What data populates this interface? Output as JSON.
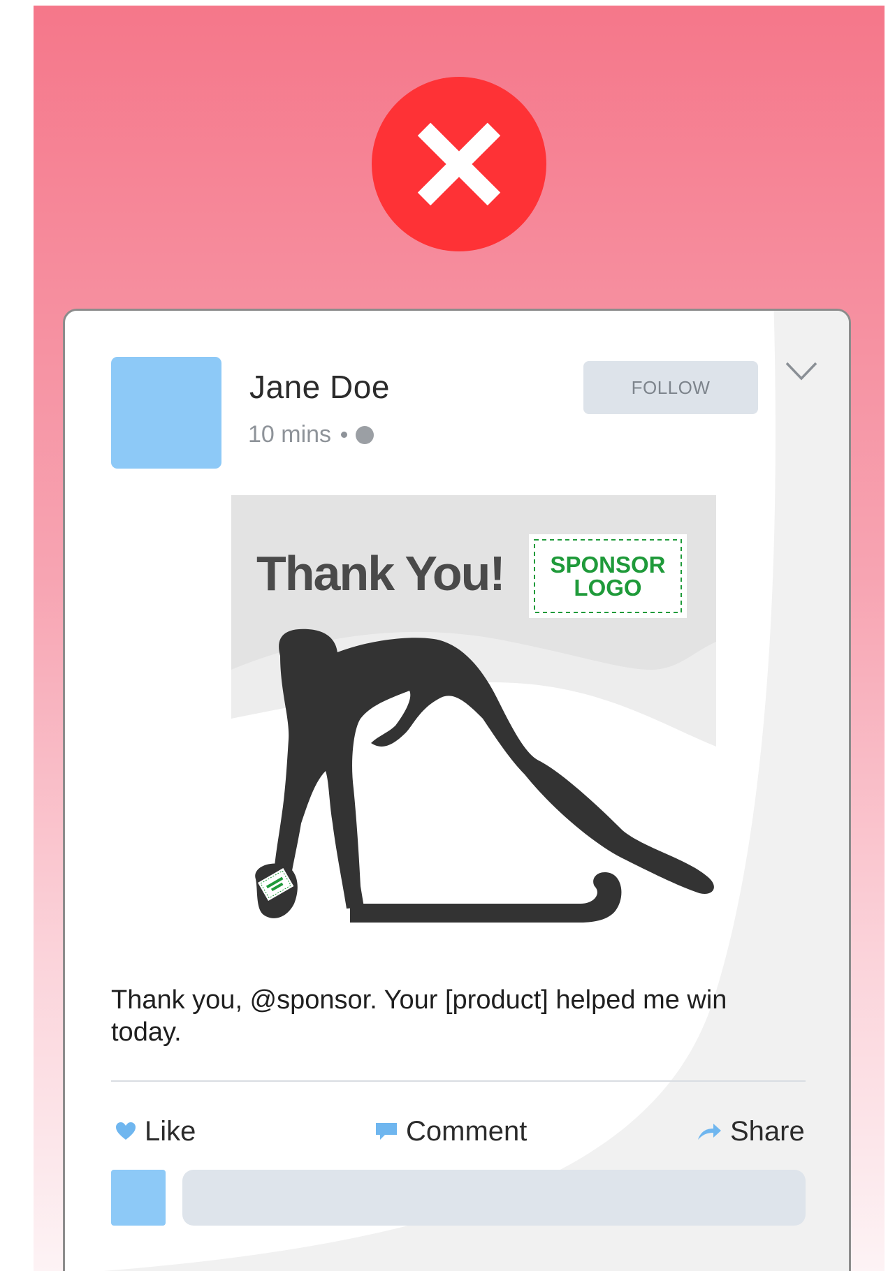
{
  "status": {
    "icon": "close-icon",
    "color": "#fe3236"
  },
  "post": {
    "author": {
      "name": "Jane Doe",
      "avatar_color": "#8dc9f7"
    },
    "time": "10 mins",
    "visibility_icon": "globe-icon",
    "follow_label": "FOLLOW",
    "menu_icon": "chevron-down-icon",
    "image": {
      "heading": "Thank You!",
      "sponsor_line1": "SPONSOR",
      "sponsor_line2": "LOGO",
      "sponsor_color": "#1f9a3a"
    },
    "text": "Thank you, @sponsor. Your [product] helped me win today."
  },
  "actions": {
    "like": {
      "label": "Like",
      "icon": "heart-icon"
    },
    "comment": {
      "label": "Comment",
      "icon": "comment-icon"
    },
    "share": {
      "label": "Share",
      "icon": "share-arrow-icon"
    }
  },
  "comment_box": {
    "placeholder": ""
  }
}
